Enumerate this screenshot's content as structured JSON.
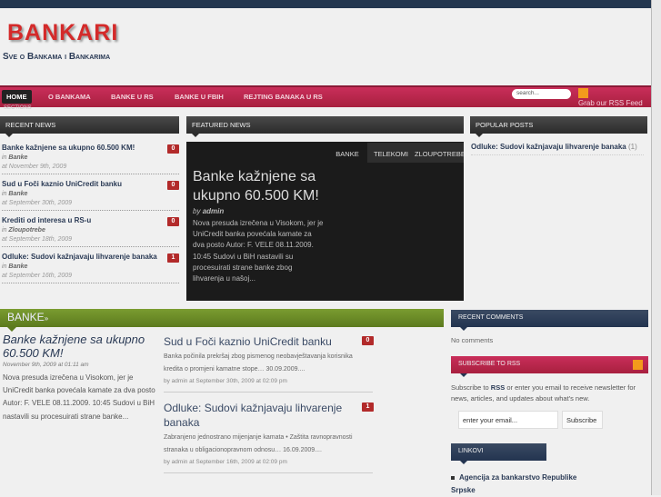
{
  "site": {
    "title": "BANKARI",
    "tagline": "Sve o Bankama i Bankarima"
  },
  "nav": {
    "items": [
      "HOME",
      "O BANKAMA",
      "BANKE U RS",
      "BANKE U FBIH",
      "REJTING BANAKA U RS"
    ],
    "sections": "SECTIONS",
    "search_placeholder": "search...",
    "rss_label": "Grab our RSS Feed"
  },
  "recent": {
    "title": "RECENT NEWS",
    "items": [
      {
        "title": "Banke kažnjene sa ukupno 60.500 KM!",
        "in": "in",
        "cat": "Banke",
        "date": "at November 9th, 2009",
        "comments": "0"
      },
      {
        "title": "Sud u Foči kaznio UniCredit banku",
        "in": "in",
        "cat": "Banke",
        "date": "at September 30th, 2009",
        "comments": "0"
      },
      {
        "title": "Krediti od interesa u RS-u",
        "in": "in",
        "cat": "Zloupotrebe",
        "date": "at September 18th, 2009",
        "comments": "0"
      },
      {
        "title": "Odluke: Sudovi kažnjavaju lihvarenje banaka",
        "in": "in",
        "cat": "Banke",
        "date": "at September 16th, 2009",
        "comments": "1"
      }
    ]
  },
  "featured": {
    "title": "FEATURED NEWS",
    "tabs": [
      "BANKE",
      "TELEKOMI",
      "ZLOUPOTREBE"
    ],
    "post_title": "Banke kažnjene sa ukupno 60.500 KM!",
    "by": "by",
    "author": "admin",
    "excerpt": "Nova presuda izrečena u Visokom, jer je UniCredit banka povećala kamate za dva posto Autor: F. VELE 08.11.2009. 10:45 Sudovi u BiH nastavili su procesuirati strane banke zbog lihvarenja u našoj..."
  },
  "popular": {
    "title": "POPULAR POSTS",
    "items": [
      {
        "title": "Odluke: Sudovi kažnjavaju lihvarenje banaka",
        "count": "(1)"
      }
    ]
  },
  "banke": {
    "title": "BANKE",
    "arrow": "»",
    "lead": {
      "title": "Banke kažnjene sa ukupno 60.500 KM!",
      "date": "November 9th, 2009 at 01:11 am",
      "excerpt": "Nova presuda izrečena u Visokom, jer je UniCredit banka povećala kamate za dva posto Autor: F. VELE 08.11.2009. 10:45 Sudovi u BiH nastavili su procesuirati strane banke..."
    },
    "articles": [
      {
        "title": "Sud u Foči kaznio UniCredit banku",
        "excerpt": "Banka počinila prekršaj zbog pismenog neobavještavanja korisnika kredita o promjeni kamatne stope… 30.09.2009....",
        "byline": "by admin at September 30th, 2009 at 02:09 pm",
        "comments": "0"
      },
      {
        "title": "Odluke: Sudovi kažnjavaju lihvarenje banaka",
        "excerpt": "Zabranjeno jednostrano mijenjanje kamata • Zaštita ravnopravnosti stranaka u obligacionopravnom odnosu… 16.09.2009....",
        "byline": "by admin at September 16th, 2009 at 02:09 pm",
        "comments": "1"
      }
    ]
  },
  "sidebar": {
    "recent_comments": "RECENT COMMENTS",
    "no_comments": "No comments",
    "subscribe_title": "SUBSCRIBE TO RSS",
    "subscribe_pre": "Subscribe to",
    "subscribe_rss": "RSS",
    "subscribe_post": "or enter you email to receive newsletter for news, articles, and updates about what's new.",
    "email_placeholder": "enter your email...",
    "subscribe_button": "Subscribe",
    "links_title": "LINKOVI",
    "links": [
      "Agencija za bankarstvo Republike Srpske"
    ]
  }
}
